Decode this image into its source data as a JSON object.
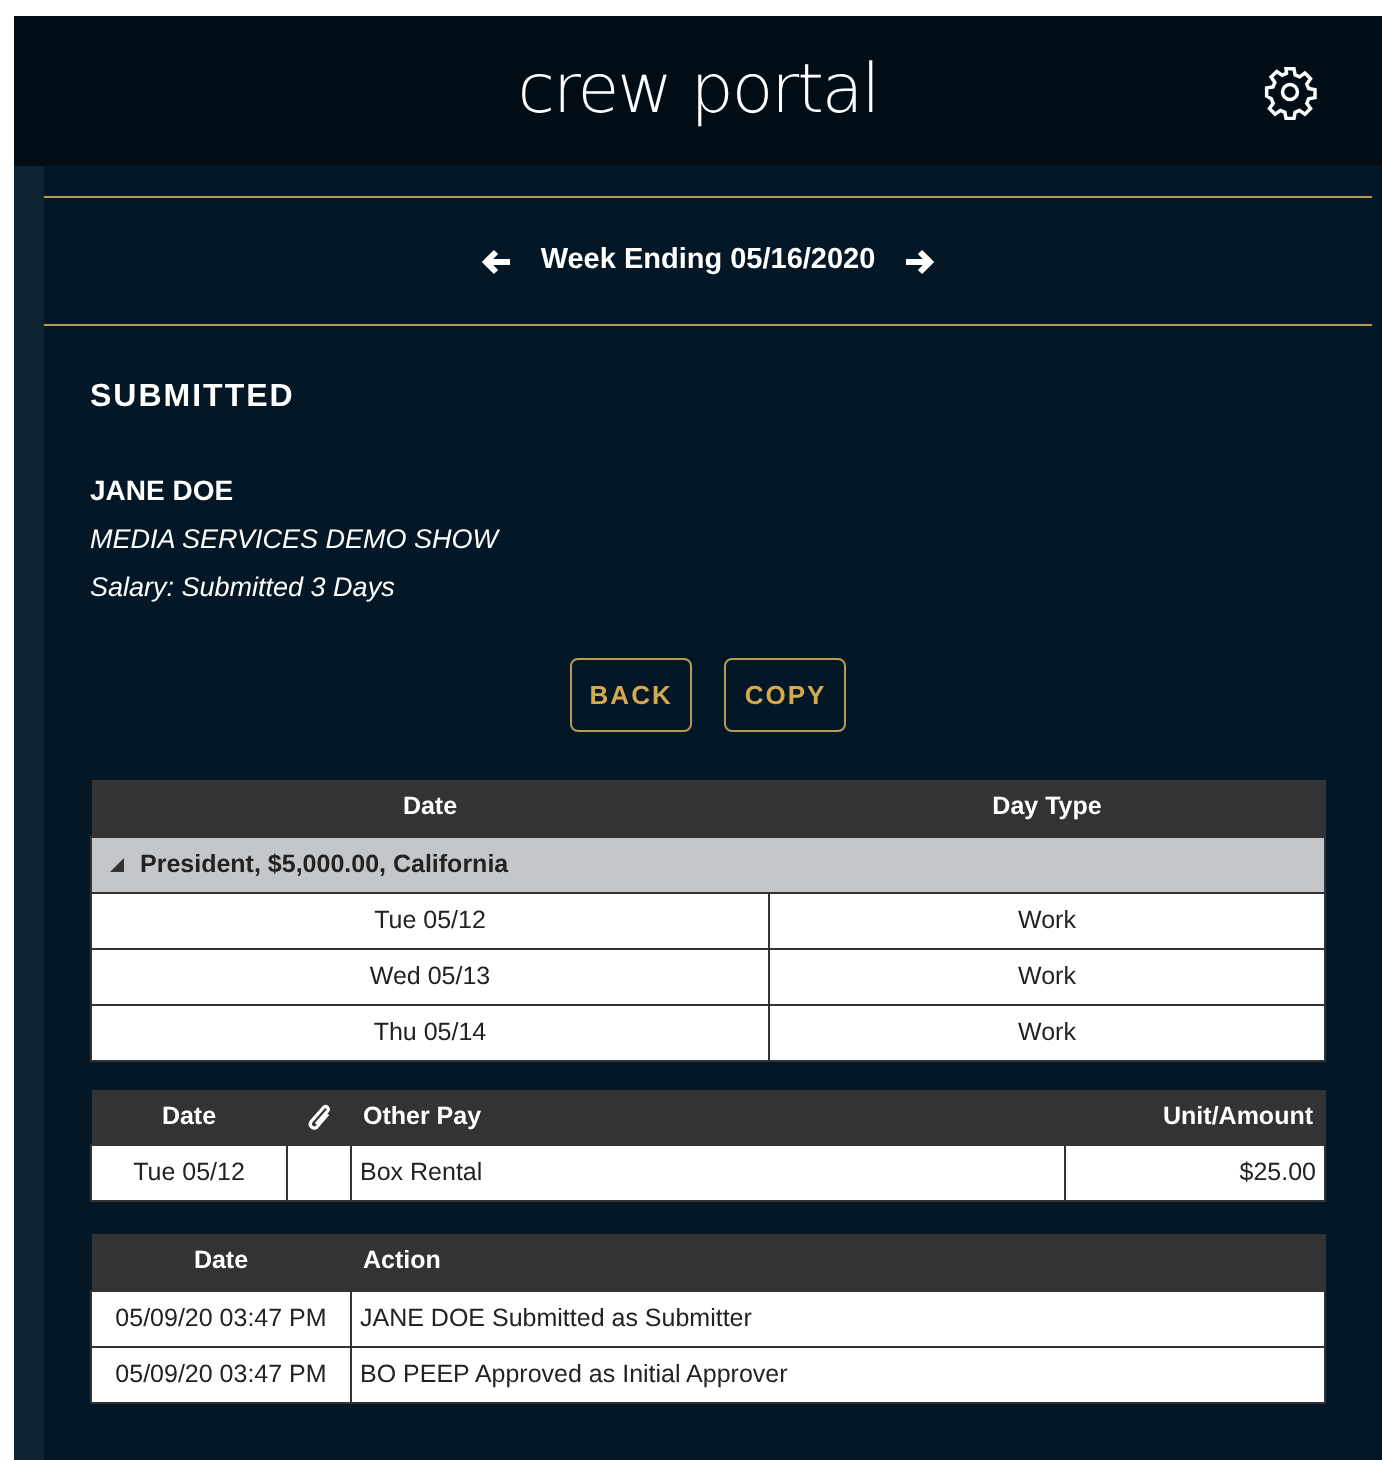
{
  "header": {
    "title": "crew portal"
  },
  "week": {
    "label": "Week Ending 05/16/2020"
  },
  "status": "SUBMITTED",
  "person": {
    "name": "JANE DOE",
    "show": "MEDIA SERVICES DEMO SHOW",
    "summary": "Salary: Submitted 3 Days"
  },
  "buttons": [
    "BACK",
    "COPY"
  ],
  "days_table": {
    "columns": [
      "Date",
      "Day Type"
    ],
    "group": {
      "label": "President, $5,000.00, California",
      "expanded": true
    },
    "rows": [
      [
        "Tue 05/12",
        "Work"
      ],
      [
        "Wed 05/13",
        "Work"
      ],
      [
        "Thu 05/14",
        "Work"
      ]
    ]
  },
  "other_pay_table": {
    "columns": [
      "Date",
      "Other Pay",
      "Unit/Amount"
    ],
    "rows": [
      [
        "Tue 05/12",
        "Box Rental",
        "$25.00"
      ]
    ]
  },
  "history_table": {
    "columns": [
      "Date",
      "Action"
    ],
    "rows": [
      [
        "05/09/20 03:47 PM",
        "JANE DOE Submitted as Submitter"
      ],
      [
        "05/09/20 03:47 PM",
        "BO PEEP Approved as Initial Approver"
      ]
    ]
  }
}
